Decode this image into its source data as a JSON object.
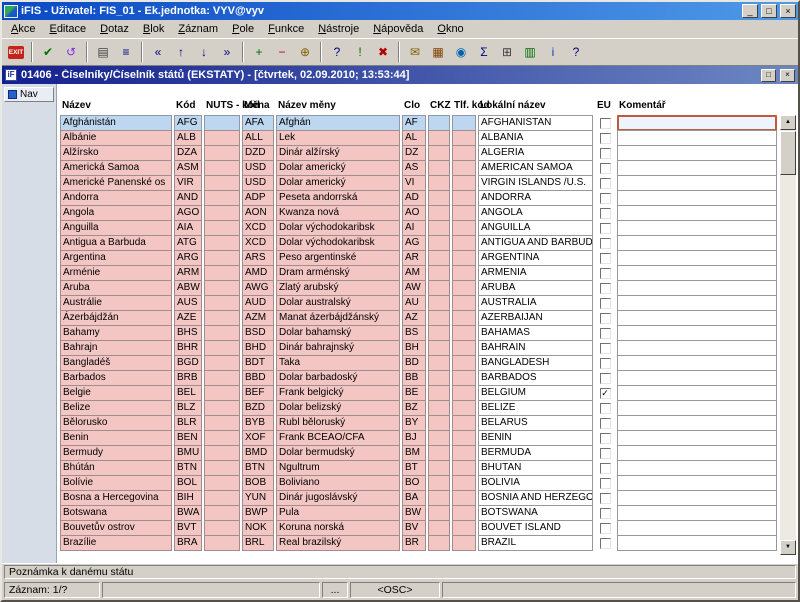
{
  "window": {
    "title": "iFIS - Uživatel: FIS_01 - Ek.jednotka: VYV@vyv",
    "controls": {
      "minimize": "_",
      "maximize": "□",
      "close": "×"
    }
  },
  "menu": {
    "items": [
      "Akce",
      "Editace",
      "Dotaz",
      "Blok",
      "Záznam",
      "Pole",
      "Funkce",
      "Nástroje",
      "Nápověda",
      "Okno"
    ]
  },
  "toolbar": {
    "icons": [
      {
        "name": "exit",
        "kind": "exit",
        "label": "EXIT"
      },
      {
        "sep": true
      },
      {
        "name": "commit",
        "glyph": "✔",
        "color": "#007000"
      },
      {
        "name": "rollback",
        "glyph": "↺",
        "color": "#8a2be2"
      },
      {
        "sep": true
      },
      {
        "name": "print",
        "glyph": "▤",
        "color": "#404040"
      },
      {
        "name": "list-of-values",
        "glyph": "≡",
        "color": "#000080"
      },
      {
        "sep": true
      },
      {
        "name": "first-record",
        "glyph": "«",
        "color": "#000080"
      },
      {
        "name": "prev-record",
        "glyph": "↑",
        "color": "#000080"
      },
      {
        "name": "next-record",
        "glyph": "↓",
        "color": "#000080"
      },
      {
        "name": "last-record",
        "glyph": "»",
        "color": "#000080"
      },
      {
        "sep": true
      },
      {
        "name": "insert-record",
        "glyph": "+",
        "color": "#007000"
      },
      {
        "name": "delete-record",
        "glyph": "−",
        "color": "#b00000"
      },
      {
        "name": "duplicate-record",
        "glyph": "⊕",
        "color": "#806000"
      },
      {
        "sep": true
      },
      {
        "name": "enter-query",
        "glyph": "?",
        "color": "#000080"
      },
      {
        "name": "execute-query",
        "glyph": "!",
        "color": "#007000"
      },
      {
        "name": "cancel-query",
        "glyph": "✖",
        "color": "#b00000"
      },
      {
        "sep": true
      },
      {
        "name": "attachments",
        "glyph": "✉",
        "color": "#806000"
      },
      {
        "name": "calendar",
        "glyph": "▦",
        "color": "#804000"
      },
      {
        "name": "world",
        "glyph": "◉",
        "color": "#0060b0"
      },
      {
        "name": "sum",
        "glyph": "Σ",
        "color": "#000080"
      },
      {
        "name": "calculator",
        "glyph": "⊞",
        "color": "#404040"
      },
      {
        "name": "export-excel",
        "glyph": "▥",
        "color": "#007000"
      },
      {
        "name": "info",
        "glyph": "i",
        "color": "#0040c0"
      },
      {
        "name": "help",
        "glyph": "?",
        "color": "#000080"
      }
    ]
  },
  "form": {
    "title": "01406 - Číselníky/Číselník států (EKSTATY) - [čtvrtek, 02.09.2010; 13:53:44]",
    "controls": {
      "restore": "□",
      "close": "×"
    }
  },
  "nav": {
    "label": "Nav"
  },
  "table": {
    "columns": [
      "Název",
      "Kód",
      "NUTS - kód",
      "Měna",
      "Název měny",
      "Clo",
      "CKZ",
      "Tlf. kód",
      "Lokální název",
      "EU",
      "Komentář"
    ],
    "rows": [
      [
        "Afghánistán",
        "AFG",
        "",
        "AFA",
        "Afghán",
        "AF",
        "",
        "",
        "AFGHANISTAN",
        false,
        ""
      ],
      [
        "Albánie",
        "ALB",
        "",
        "ALL",
        "Lek",
        "AL",
        "",
        "",
        "ALBANIA",
        false,
        ""
      ],
      [
        "Alžírsko",
        "DZA",
        "",
        "DZD",
        "Dinár alžírský",
        "DZ",
        "",
        "",
        "ALGERIA",
        false,
        ""
      ],
      [
        "Americká Samoa",
        "ASM",
        "",
        "USD",
        "Dolar americký",
        "AS",
        "",
        "",
        "AMERICAN SAMOA",
        false,
        ""
      ],
      [
        "Americké Panenské os",
        "VIR",
        "",
        "USD",
        "Dolar americký",
        "VI",
        "",
        "",
        "VIRGIN ISLANDS /U.S.",
        false,
        ""
      ],
      [
        "Andorra",
        "AND",
        "",
        "ADP",
        "Peseta andorrská",
        "AD",
        "",
        "",
        "ANDORRA",
        false,
        ""
      ],
      [
        "Angola",
        "AGO",
        "",
        "AON",
        "Kwanza nová",
        "AO",
        "",
        "",
        "ANGOLA",
        false,
        ""
      ],
      [
        "Anguilla",
        "AIA",
        "",
        "XCD",
        "Dolar východokaribsk",
        "AI",
        "",
        "",
        "ANGUILLA",
        false,
        ""
      ],
      [
        "Antigua a Barbuda",
        "ATG",
        "",
        "XCD",
        "Dolar východokaribsk",
        "AG",
        "",
        "",
        "ANTIGUA AND BARBUDA",
        false,
        ""
      ],
      [
        "Argentina",
        "ARG",
        "",
        "ARS",
        "Peso argentinské",
        "AR",
        "",
        "",
        "ARGENTINA",
        false,
        ""
      ],
      [
        "Arménie",
        "ARM",
        "",
        "AMD",
        "Dram arménský",
        "AM",
        "",
        "",
        "ARMENIA",
        false,
        ""
      ],
      [
        "Aruba",
        "ABW",
        "",
        "AWG",
        "Zlatý arubský",
        "AW",
        "",
        "",
        "ARUBA",
        false,
        ""
      ],
      [
        "Austrálie",
        "AUS",
        "",
        "AUD",
        "Dolar australský",
        "AU",
        "",
        "",
        "AUSTRALIA",
        false,
        ""
      ],
      [
        "Ázerbájdžán",
        "AZE",
        "",
        "AZM",
        "Manat ázerbájdžánský",
        "AZ",
        "",
        "",
        "AZERBAIJAN",
        false,
        ""
      ],
      [
        "Bahamy",
        "BHS",
        "",
        "BSD",
        "Dolar bahamský",
        "BS",
        "",
        "",
        "BAHAMAS",
        false,
        ""
      ],
      [
        "Bahrajn",
        "BHR",
        "",
        "BHD",
        "Dinár bahrajnský",
        "BH",
        "",
        "",
        "BAHRAIN",
        false,
        ""
      ],
      [
        "Bangladéš",
        "BGD",
        "",
        "BDT",
        "Taka",
        "BD",
        "",
        "",
        "BANGLADESH",
        false,
        ""
      ],
      [
        "Barbados",
        "BRB",
        "",
        "BBD",
        "Dolar barbadoský",
        "BB",
        "",
        "",
        "BARBADOS",
        false,
        ""
      ],
      [
        "Belgie",
        "BEL",
        "",
        "BEF",
        "Frank belgický",
        "BE",
        "",
        "",
        "BELGIUM",
        true,
        ""
      ],
      [
        "Belize",
        "BLZ",
        "",
        "BZD",
        "Dolar belizský",
        "BZ",
        "",
        "",
        "BELIZE",
        false,
        ""
      ],
      [
        "Bělorusko",
        "BLR",
        "",
        "BYB",
        "Rubl běloruský",
        "BY",
        "",
        "",
        "BELARUS",
        false,
        ""
      ],
      [
        "Benin",
        "BEN",
        "",
        "XOF",
        "Frank BCEAO/CFA",
        "BJ",
        "",
        "",
        "BENIN",
        false,
        ""
      ],
      [
        "Bermudy",
        "BMU",
        "",
        "BMD",
        "Dolar bermudský",
        "BM",
        "",
        "",
        "BERMUDA",
        false,
        ""
      ],
      [
        "Bhútán",
        "BTN",
        "",
        "BTN",
        "Ngultrum",
        "BT",
        "",
        "",
        "BHUTAN",
        false,
        ""
      ],
      [
        "Bolívie",
        "BOL",
        "",
        "BOB",
        "Boliviano",
        "BO",
        "",
        "",
        "BOLIVIA",
        false,
        ""
      ],
      [
        "Bosna a Hercegovina",
        "BIH",
        "",
        "YUN",
        "Dinár jugoslávský",
        "BA",
        "",
        "",
        "BOSNIA AND HERZEGOVI",
        false,
        ""
      ],
      [
        "Botswana",
        "BWA",
        "",
        "BWP",
        "Pula",
        "BW",
        "",
        "",
        "BOTSWANA",
        false,
        ""
      ],
      [
        "Bouvetův ostrov",
        "BVT",
        "",
        "NOK",
        "Koruna norská",
        "BV",
        "",
        "",
        "BOUVET ISLAND",
        false,
        ""
      ],
      [
        "Brazílie",
        "BRA",
        "",
        "BRL",
        "Real brazilský",
        "BR",
        "",
        "",
        "BRAZIL",
        false,
        ""
      ]
    ]
  },
  "status": {
    "hint": "Poznámka k danému státu",
    "panels": [
      "Záznam: 1/?",
      "",
      "...",
      "<OSC>",
      ""
    ]
  },
  "colors": {
    "row_pink": "#f3c6c3",
    "row_selected": "#bdd7f0",
    "focus_border": "#c05a3a",
    "titlebar_blue": "#0a49c4",
    "mdi_blue": "#14208e"
  }
}
